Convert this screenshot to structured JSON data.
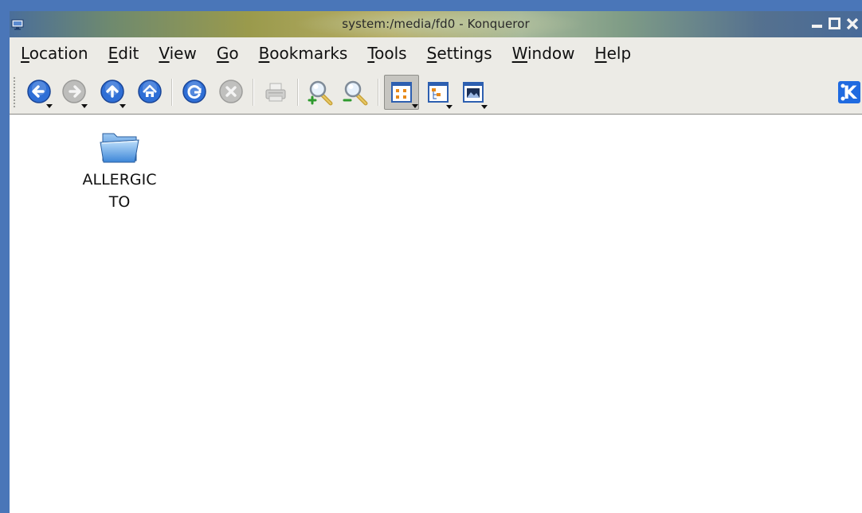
{
  "window": {
    "title": "system:/media/fd0 - Konqueror"
  },
  "menubar": {
    "items": [
      {
        "label": "Location",
        "mnemonic": "L",
        "rest": "ocation"
      },
      {
        "label": "Edit",
        "mnemonic": "E",
        "rest": "dit"
      },
      {
        "label": "View",
        "mnemonic": "V",
        "rest": "iew"
      },
      {
        "label": "Go",
        "mnemonic": "G",
        "rest": "o"
      },
      {
        "label": "Bookmarks",
        "mnemonic": "B",
        "rest": "ookmarks"
      },
      {
        "label": "Tools",
        "mnemonic": "T",
        "rest": "ools"
      },
      {
        "label": "Settings",
        "mnemonic": "S",
        "rest": "ettings"
      },
      {
        "label": "Window",
        "mnemonic": "W",
        "rest": "indow"
      },
      {
        "label": "Help",
        "mnemonic": "H",
        "rest": "elp"
      }
    ]
  },
  "toolbar": {
    "buttons": [
      {
        "name": "back",
        "icon": "back-arrow-icon",
        "enabled": true,
        "has_dropdown": true
      },
      {
        "name": "forward",
        "icon": "forward-arrow-icon",
        "enabled": false,
        "has_dropdown": true
      },
      {
        "name": "up",
        "icon": "up-arrow-icon",
        "enabled": true,
        "has_dropdown": true
      },
      {
        "name": "home",
        "icon": "home-icon",
        "enabled": true,
        "has_dropdown": false
      },
      {
        "name": "reload",
        "icon": "reload-icon",
        "enabled": true,
        "has_dropdown": false
      },
      {
        "name": "stop",
        "icon": "stop-icon",
        "enabled": false,
        "has_dropdown": false
      },
      {
        "name": "print",
        "icon": "printer-icon",
        "enabled": false,
        "has_dropdown": false
      },
      {
        "name": "zoom-in",
        "icon": "zoom-in-icon",
        "enabled": true,
        "has_dropdown": false
      },
      {
        "name": "zoom-out",
        "icon": "zoom-out-icon",
        "enabled": true,
        "has_dropdown": false
      },
      {
        "name": "icon-view",
        "icon": "icon-view-icon",
        "enabled": true,
        "pressed": true,
        "has_dropdown": true
      },
      {
        "name": "tree-view",
        "icon": "tree-view-icon",
        "enabled": true,
        "has_dropdown": true
      },
      {
        "name": "image-view",
        "icon": "image-view-icon",
        "enabled": true,
        "has_dropdown": true
      }
    ],
    "brand_icon": "kde-logo-icon"
  },
  "content": {
    "items": [
      {
        "name_line1": "ALLERGIC",
        "name_line2": "TO",
        "icon": "folder-icon"
      }
    ]
  },
  "colors": {
    "accent_blue": "#2f6fd6",
    "desktop": "#4a76b8"
  }
}
